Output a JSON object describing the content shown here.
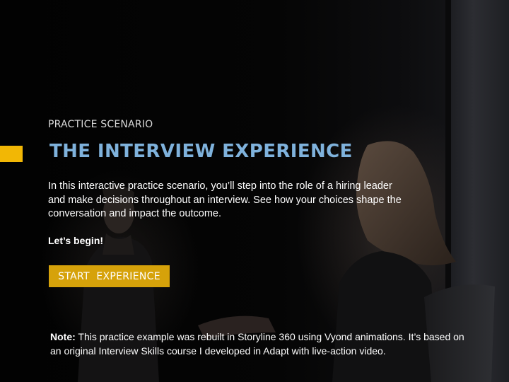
{
  "slide": {
    "eyebrow": "PRACTICE SCENARIO",
    "title": "THE INTERVIEW EXPERIENCE",
    "intro": "In this interactive practice scenario, you’ll step into the role of a hiring leader and make decisions throughout an interview. See how your choices shape the conversation and impact the outcome.",
    "lets_begin": "Let’s begin!",
    "start_button_label": "START  EXPERIENCE",
    "note_label": "Note:",
    "note_text": " This practice example was rebuilt in Storyline 360 using Vyond animations. It’s based on an original Interview Skills course I developed in Adapt with live-action video."
  },
  "colors": {
    "accent": "#f2b705",
    "button": "#d6a20a",
    "title": "#7fb2dc",
    "background": "#000000"
  }
}
